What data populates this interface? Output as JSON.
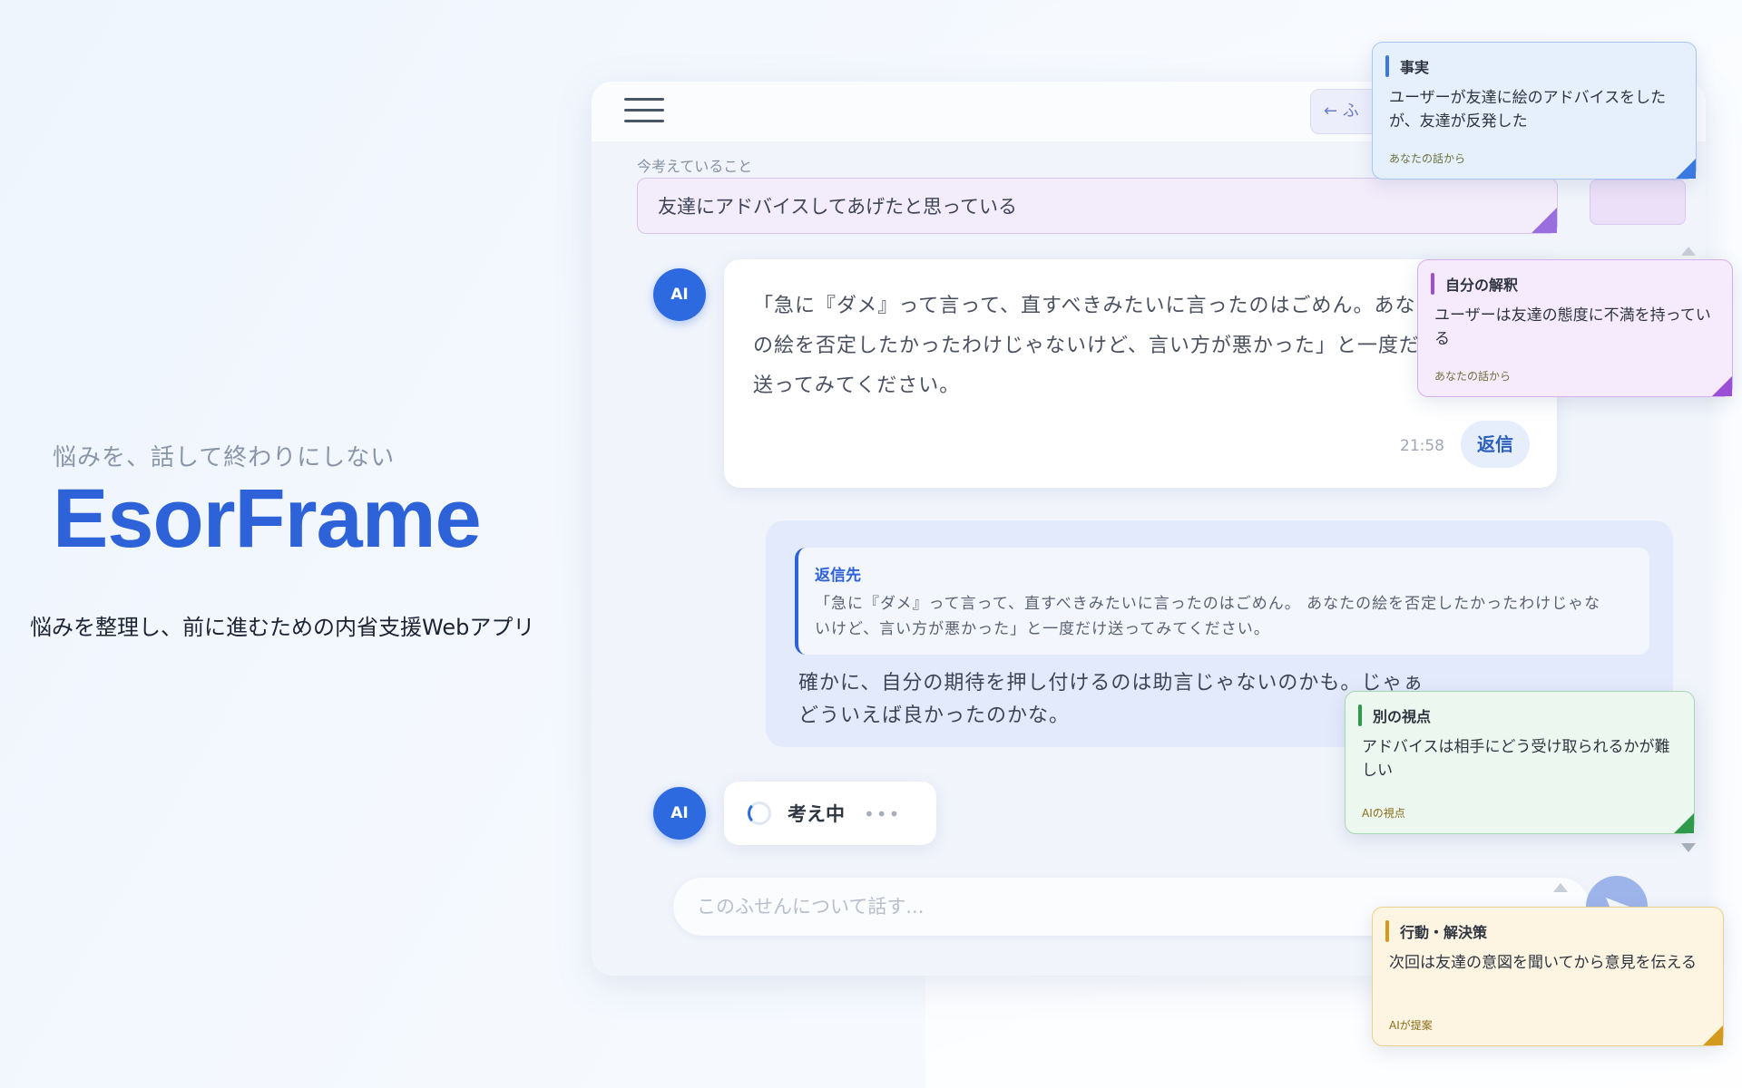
{
  "hero": {
    "tagline": "悩みを、話して終わりにしない",
    "brand": "EsorFrame",
    "description": "悩みを整理し、前に進むための内省支援Webアプリ"
  },
  "app": {
    "back_label": "← ふ",
    "thinking_label": "今考えていること",
    "thinking_value": "友達にアドバイスしてあげたと思っている",
    "ai_avatar": "AI",
    "ai_message": "「急に『ダメ』って言って、直すべきみたいに言ったのはごめん。あなたの絵を否定したかったわけじゃないけど、言い方が悪かった」と一度だけ送ってみてください。",
    "ai_time": "21:58",
    "reply_label": "返信",
    "reply_quote_title": "返信先",
    "reply_quote_text": "「急に『ダメ』って言って、直すべきみたいに言ったのはごめん。 あなたの絵を否定したかったわけじゃないけど、言い方が悪かった」と一度だけ送ってみてください。",
    "user_message": "確かに、自分の期待を押し付けるのは助言じゃないのかも。じゃぁどういえば良かったのかな。",
    "thinking_status": "考え中",
    "thinking_dots": "•••",
    "input_placeholder": "このふせんについて話す...",
    "send_icon": "send-icon"
  },
  "notes": [
    {
      "category": "事実",
      "text": "ユーザーが友達に絵のアドバイスをしたが、友達が反発した",
      "source": "あなたの話から",
      "color": "#3b78e0"
    },
    {
      "category": "自分の解釈",
      "text": "ユーザーは友達の態度に不満を持っている",
      "source": "あなたの話から",
      "color": "#9b4fd6"
    },
    {
      "category": "別の視点",
      "text": "アドバイスは相手にどう受け取られるかが難しい",
      "source": "AIの視点",
      "color": "#2f9a4c"
    },
    {
      "category": "行動・解決策",
      "text": "次回は友達の意図を聞いてから意見を伝える",
      "source": "AIが提案",
      "color": "#d49a1e"
    }
  ]
}
